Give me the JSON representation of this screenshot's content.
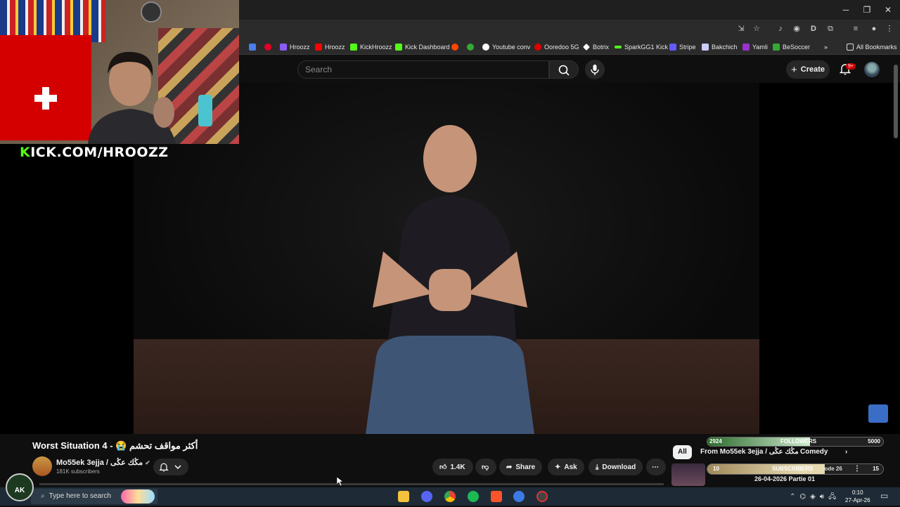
{
  "browser": {
    "bookmarks": [
      {
        "label": "Hroozz",
        "color": "#8b5cf6"
      },
      {
        "label": "Hroozz",
        "color": "#ff0000"
      },
      {
        "label": "KickHroozz",
        "color": "#53fc18"
      },
      {
        "label": "Kick Dashboard",
        "color": "#53fc18"
      },
      {
        "label": "Youtube conv",
        "color": "#ffffff"
      },
      {
        "label": "Ooredoo 5G",
        "color": "#e00000"
      },
      {
        "label": "Botrix",
        "color": "#ffffff"
      },
      {
        "label": "SparkGG1 Kick",
        "color": "#53fc18"
      },
      {
        "label": "Stripe",
        "color": "#635bff"
      },
      {
        "label": "Bakchich",
        "color": "#ccccff"
      },
      {
        "label": "Yamli",
        "color": "#9933cc"
      },
      {
        "label": "BeSoccer",
        "color": "#33aa33"
      }
    ],
    "all_bookmarks": "All Bookmarks"
  },
  "youtube": {
    "search_placeholder": "Search",
    "create_label": "Create",
    "notif_badge": "9+"
  },
  "overlay": {
    "kick_k": "K",
    "kick_rest": "ICK.COM/HROOZZ",
    "followers_count": "2924",
    "followers_label": "FOLLOWERS",
    "followers_goal": "5000",
    "followers_progress": 0.585,
    "subs_count": "10",
    "subs_label": "SUBSCRIBERS",
    "subs_goal": "15",
    "subs_progress": 0.667,
    "logo_text": "AK"
  },
  "video": {
    "title": "Worst Situation 4 - 😭 أكثر مواقف تحشم",
    "channel_name": "Mo55ek 3ejja / مڭك عڭى",
    "subscribers": "181K subscribers",
    "likes": "1.4K",
    "share_label": "Share",
    "ask_label": "Ask",
    "download_label": "Download"
  },
  "sidebar": {
    "chips": [
      "All",
      "From Mo55ek 3ejja / مڭك عڭى",
      "Comedy"
    ],
    "next_title_partial": "sode 26",
    "next_date": "26-04-2026 Partie 01"
  },
  "taskbar": {
    "search_placeholder": "Type here to search",
    "time": "0:10",
    "date": "27-Apr-26"
  }
}
